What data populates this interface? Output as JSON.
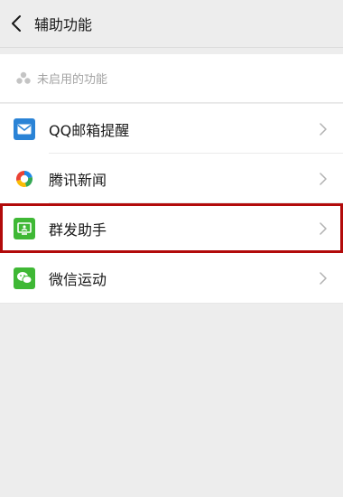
{
  "header": {
    "title": "辅助功能"
  },
  "section": {
    "label": "未启用的功能"
  },
  "items": [
    {
      "label": "QQ邮箱提醒",
      "icon": "mail-icon",
      "color": "#2a83d6"
    },
    {
      "label": "腾讯新闻",
      "icon": "news-icon",
      "color": "#2c8cdc"
    },
    {
      "label": "群发助手",
      "icon": "broadcast-icon",
      "color": "#3fb835",
      "highlighted": true
    },
    {
      "label": "微信运动",
      "icon": "chat-icon",
      "color": "#3fb835"
    }
  ],
  "colors": {
    "highlight_border": "#b20a0a",
    "background": "#ededed"
  }
}
